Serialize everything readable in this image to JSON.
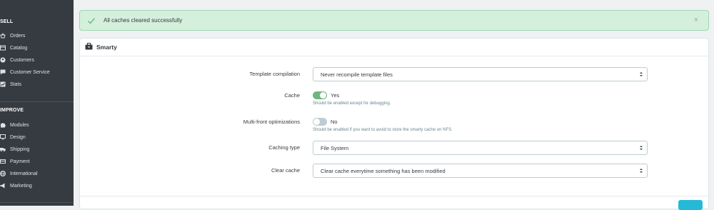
{
  "sidebar": {
    "sections": [
      {
        "title": "SELL",
        "items": [
          {
            "label": "Orders",
            "icon": "orders-icon"
          },
          {
            "label": "Catalog",
            "icon": "catalog-icon"
          },
          {
            "label": "Customers",
            "icon": "customers-icon"
          },
          {
            "label": "Customer Service",
            "icon": "customer-service-icon"
          },
          {
            "label": "Stats",
            "icon": "stats-icon"
          }
        ]
      },
      {
        "title": "IMPROVE",
        "items": [
          {
            "label": "Modules",
            "icon": "modules-icon"
          },
          {
            "label": "Design",
            "icon": "design-icon"
          },
          {
            "label": "Shipping",
            "icon": "shipping-icon"
          },
          {
            "label": "Payment",
            "icon": "payment-icon"
          },
          {
            "label": "International",
            "icon": "international-icon"
          },
          {
            "label": "Marketing",
            "icon": "marketing-icon"
          }
        ]
      }
    ]
  },
  "alert": {
    "message": "All caches cleared successfully",
    "close": "×"
  },
  "panel": {
    "title": "Smarty",
    "fields": {
      "template_compilation": {
        "label": "Template compilation",
        "value": "Never recompile template files"
      },
      "cache": {
        "label": "Cache",
        "state": "Yes",
        "on": true,
        "help": "Should be enabled except for debugging."
      },
      "multi_front": {
        "label": "Multi-front optimizations",
        "state": "No",
        "on": false,
        "help": "Should be enabled if you want to avoid to store the smarty cache on NFS."
      },
      "caching_type": {
        "label": "Caching type",
        "value": "File System"
      },
      "clear_cache": {
        "label": "Clear cache",
        "value": "Clear cache everytime something has been modified"
      }
    }
  },
  "colors": {
    "sidebar_bg": "#363a41",
    "success_bg": "#d4f0dc",
    "toggle_on": "#70b580",
    "accent": "#25b9d7"
  }
}
